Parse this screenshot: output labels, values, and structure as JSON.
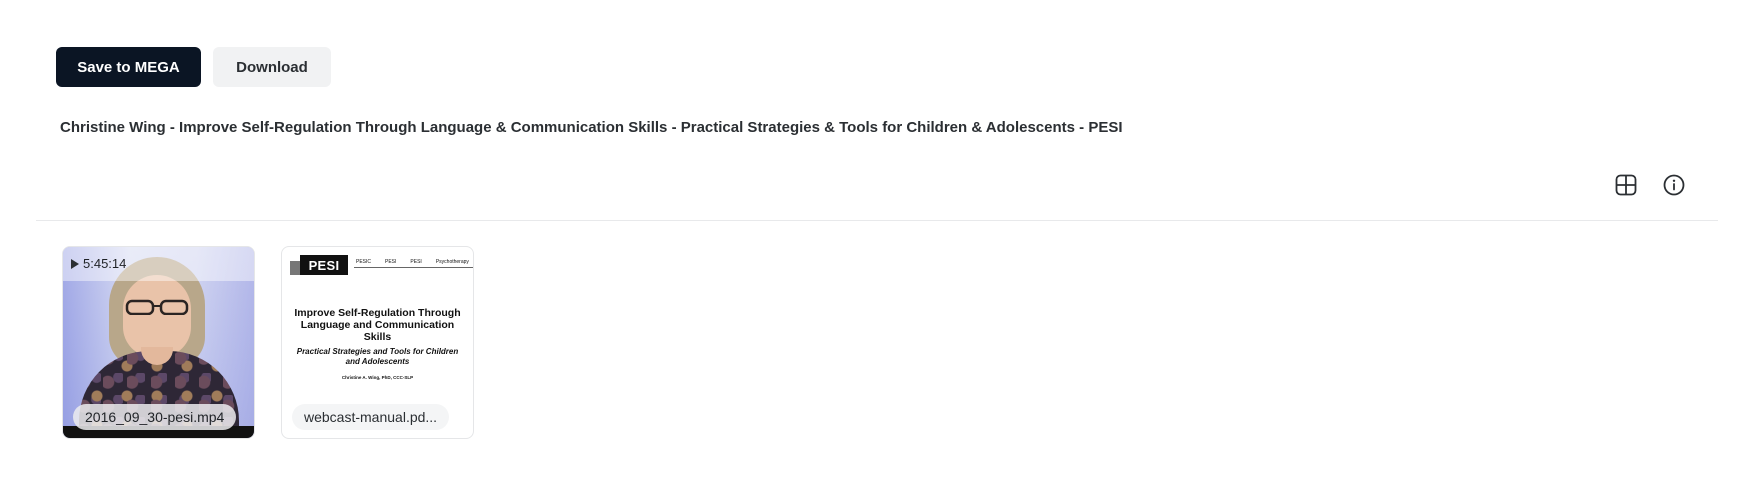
{
  "toolbar": {
    "save_label": "Save to MEGA",
    "download_label": "Download"
  },
  "folder": {
    "title": "Christine Wing - Improve Self-Regulation Through Language & Communication Skills - Practical Strategies & Tools for Children & Adolescents - PESI"
  },
  "view_controls": {
    "grid_icon": "grid-icon",
    "info_icon": "info-icon"
  },
  "files": [
    {
      "name": "2016_09_30-pesi.mp4",
      "type": "video",
      "duration": "5:45:14",
      "icon": "play-icon"
    },
    {
      "name": "webcast-manual.pd...",
      "type": "pdf",
      "thumbnail": {
        "logo": "PESI",
        "partner_logos": [
          "PESIC",
          "PESI",
          "PESI",
          "Psychotherapy"
        ],
        "title": "Improve Self-Regulation Through Language and Communication Skills",
        "subtitle": "Practical Strategies and Tools for Children and Adolescents",
        "author": "Christine A. Wing, PhD, CCC-SLP"
      }
    }
  ],
  "colors": {
    "primary_button": "#0b1524",
    "secondary_button": "#f1f2f3",
    "divider": "#e8e9eb"
  }
}
